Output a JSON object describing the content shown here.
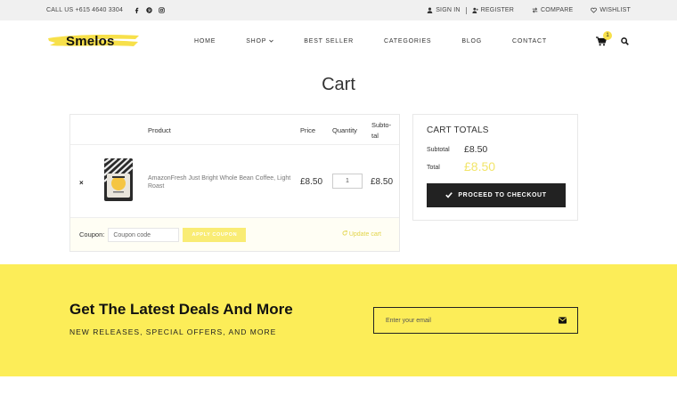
{
  "topbar": {
    "phone": "CALL US +615 4640 3304",
    "sign_in": "SIGN IN",
    "register": "REGISTER",
    "compare": "COMPARE",
    "wishlist": "WISHLIST"
  },
  "header": {
    "logo": "Smelos",
    "nav": {
      "home": "HOME",
      "shop": "SHOP",
      "best_seller": "BEST SELLER",
      "categories": "CATEGORIES",
      "blog": "BLOG",
      "contact": "CONTACT"
    },
    "cart_count": "1"
  },
  "page": {
    "title": "Cart"
  },
  "cart": {
    "headers": {
      "product": "Product",
      "price": "Price",
      "quantity": "Quantity",
      "subtotal_1": "Subto-",
      "subtotal_2": "tal"
    },
    "item": {
      "remove": "×",
      "name": "AmazonFresh Just Bright Whole Bean Coffee, Light Roast",
      "price": "£8.50",
      "quantity": "1",
      "subtotal": "£8.50"
    },
    "coupon": {
      "label": "Coupon:",
      "placeholder": "Coupon code",
      "apply": "APPLY COUPON",
      "update": "Update cart"
    }
  },
  "totals": {
    "title": "CART TOTALS",
    "subtotal_label": "Subtotal",
    "subtotal_value": "£8.50",
    "total_label": "Total",
    "total_value": "£8.50",
    "checkout": "PROCEED TO CHECKOUT"
  },
  "newsletter": {
    "title": "Get The Latest Deals And More",
    "subtitle": "NEW RELEASES, SPECIAL OFFERS, AND MORE",
    "placeholder": "Enter your email"
  },
  "colors": {
    "accent": "#fced58",
    "accent_text": "#e2d54a",
    "dark": "#222222"
  }
}
